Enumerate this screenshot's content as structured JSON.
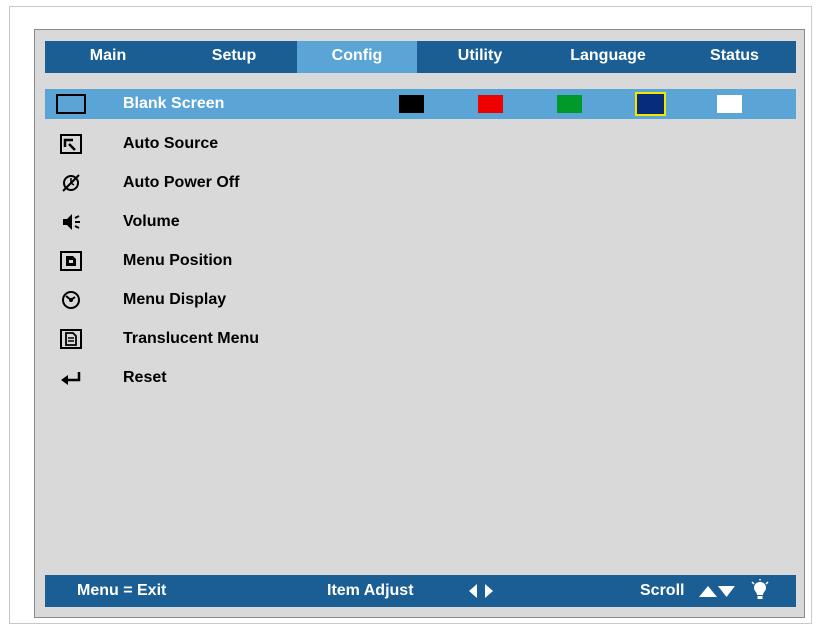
{
  "tabs": [
    {
      "label": "Main",
      "active": false
    },
    {
      "label": "Setup",
      "active": false
    },
    {
      "label": "Config",
      "active": true
    },
    {
      "label": "Utility",
      "active": false
    },
    {
      "label": "Language",
      "active": false
    },
    {
      "label": "Status",
      "active": false
    }
  ],
  "menu": {
    "items": [
      {
        "label": "Blank Screen",
        "icon": "blank-screen-icon",
        "selected": true
      },
      {
        "label": "Auto Source",
        "icon": "auto-source-icon",
        "selected": false
      },
      {
        "label": "Auto Power Off",
        "icon": "auto-power-off-icon",
        "selected": false
      },
      {
        "label": "Volume",
        "icon": "volume-icon",
        "selected": false
      },
      {
        "label": "Menu Position",
        "icon": "menu-position-icon",
        "selected": false
      },
      {
        "label": "Menu Display",
        "icon": "menu-display-icon",
        "selected": false
      },
      {
        "label": "Translucent Menu",
        "icon": "translucent-menu-icon",
        "selected": false
      },
      {
        "label": "Reset",
        "icon": "reset-icon",
        "selected": false
      }
    ],
    "blank_screen_colors": [
      {
        "name": "black",
        "color": "#000000",
        "active": false
      },
      {
        "name": "red",
        "color": "#ee0000",
        "active": false
      },
      {
        "name": "green",
        "color": "#009a2a",
        "active": false
      },
      {
        "name": "blue",
        "color": "#072d7a",
        "active": true
      },
      {
        "name": "white",
        "color": "#ffffff",
        "active": false
      }
    ]
  },
  "footer": {
    "exit_hint": "Menu = Exit",
    "adjust_hint": "Item Adjust",
    "scroll_hint": "Scroll"
  },
  "colors": {
    "bar": "#1a5e94",
    "highlight": "#5ba4d6",
    "panel": "#d9d9d9",
    "swatch_outline": "#f2e600"
  }
}
